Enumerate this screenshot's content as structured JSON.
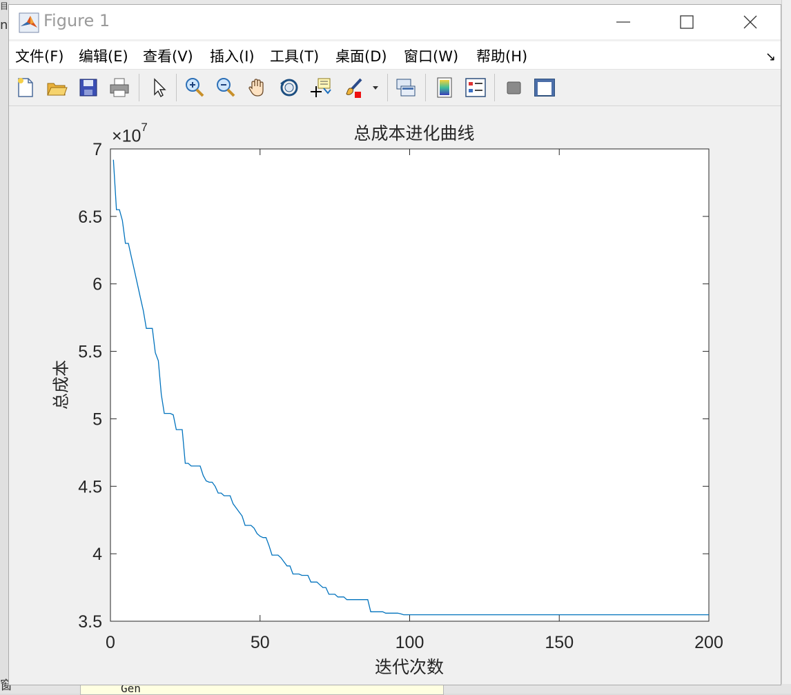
{
  "background": {
    "top_left_fragment": "目",
    "left_fragment": "nt",
    "bottom_left_fragment": "窗",
    "panel_text": "Gen"
  },
  "window": {
    "title": "Figure 1",
    "app_icon": "matlab-icon",
    "controls": {
      "minimize": "minimize-icon",
      "maximize": "maximize-icon",
      "close": "close-icon"
    }
  },
  "menu": {
    "items": [
      {
        "label": "文件(F)"
      },
      {
        "label": "编辑(E)"
      },
      {
        "label": "查看(V)"
      },
      {
        "label": "插入(I)"
      },
      {
        "label": "工具(T)"
      },
      {
        "label": "桌面(D)"
      },
      {
        "label": "窗口(W)"
      },
      {
        "label": "帮助(H)"
      }
    ],
    "dock_icon": "↘"
  },
  "toolbar": {
    "tools": [
      "new-figure-icon",
      "open-file-icon",
      "save-icon",
      "print-icon",
      "edit-plot-arrow-icon",
      "zoom-in-icon",
      "zoom-out-icon",
      "pan-hand-icon",
      "rotate-3d-icon",
      "data-cursor-icon",
      "brush-icon",
      "brush-dropdown-icon",
      "link-plot-icon",
      "colorbar-icon",
      "legend-icon",
      "hide-plot-tools-icon",
      "show-plot-tools-icon"
    ]
  },
  "colors": {
    "line": "#0072bd",
    "axes": "#262626",
    "plot_bg": "#ffffff",
    "figure_bg": "#f0f0f0"
  },
  "chart_data": {
    "type": "line",
    "title": "总成本进化曲线",
    "xlabel": "迭代次数",
    "ylabel": "总成本",
    "y_exponent_label": "×10",
    "y_exponent": "7",
    "xlim": [
      0,
      200
    ],
    "ylim": [
      3.5,
      7
    ],
    "xticks": [
      0,
      50,
      100,
      150,
      200
    ],
    "xtick_labels": [
      "0",
      "50",
      "100",
      "150",
      "200"
    ],
    "yticks": [
      3.5,
      4,
      4.5,
      5,
      5.5,
      6,
      6.5,
      7
    ],
    "ytick_labels": [
      "3.5",
      "4",
      "4.5",
      "5",
      "5.5",
      "6",
      "6.5",
      "7"
    ],
    "grid": false,
    "series": [
      {
        "x": [
          1,
          2,
          3,
          4,
          5,
          6,
          7,
          8,
          9,
          10,
          11,
          12,
          13,
          14,
          15,
          16,
          17,
          18,
          19,
          20,
          21,
          22,
          23,
          24,
          25,
          26,
          27,
          28,
          29,
          30,
          31,
          32,
          33,
          34,
          35,
          36,
          37,
          38,
          39,
          40,
          41,
          42,
          43,
          44,
          45,
          46,
          47,
          48,
          49,
          50,
          51,
          52,
          53,
          54,
          55,
          56,
          57,
          58,
          59,
          60,
          61,
          62,
          63,
          64,
          65,
          66,
          67,
          68,
          69,
          70,
          71,
          72,
          73,
          74,
          75,
          76,
          77,
          78,
          79,
          80,
          81,
          82,
          83,
          84,
          85,
          86,
          87,
          88,
          89,
          90,
          91,
          92,
          93,
          94,
          95,
          96,
          97,
          98,
          99,
          100,
          120,
          140,
          160,
          180,
          200
        ],
        "y": [
          6.92,
          6.55,
          6.55,
          6.47,
          6.3,
          6.3,
          6.2,
          6.1,
          6.0,
          5.9,
          5.8,
          5.67,
          5.67,
          5.67,
          5.49,
          5.43,
          5.18,
          5.04,
          5.04,
          5.04,
          5.03,
          4.92,
          4.92,
          4.92,
          4.67,
          4.67,
          4.65,
          4.65,
          4.65,
          4.65,
          4.58,
          4.54,
          4.53,
          4.53,
          4.5,
          4.45,
          4.45,
          4.43,
          4.43,
          4.43,
          4.37,
          4.34,
          4.31,
          4.28,
          4.21,
          4.21,
          4.21,
          4.19,
          4.15,
          4.13,
          4.12,
          4.12,
          4.06,
          3.99,
          3.99,
          3.99,
          3.97,
          3.94,
          3.91,
          3.91,
          3.85,
          3.85,
          3.85,
          3.84,
          3.84,
          3.84,
          3.79,
          3.79,
          3.79,
          3.77,
          3.75,
          3.75,
          3.7,
          3.7,
          3.7,
          3.68,
          3.68,
          3.68,
          3.66,
          3.66,
          3.66,
          3.66,
          3.66,
          3.66,
          3.66,
          3.66,
          3.57,
          3.57,
          3.57,
          3.57,
          3.57,
          3.56,
          3.56,
          3.56,
          3.56,
          3.56,
          3.555,
          3.548,
          3.548,
          3.548,
          3.548,
          3.548,
          3.548,
          3.548,
          3.548
        ]
      }
    ]
  }
}
